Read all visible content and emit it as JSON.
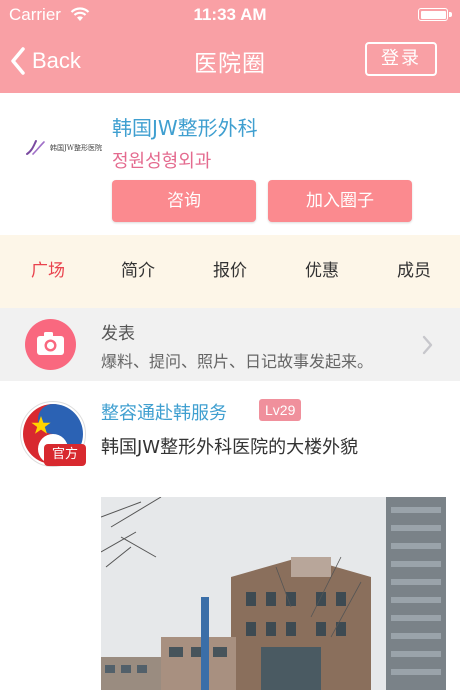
{
  "status_bar": {
    "carrier": "Carrier",
    "time": "11:33 AM"
  },
  "nav": {
    "back_label": "Back",
    "title": "医院圈",
    "login_label": "登录"
  },
  "hospital": {
    "logo_text": "韩国JW整形医院",
    "name_cn": "韩国JW整形外科",
    "name_kr": "정원성형외과",
    "consult_label": "咨询",
    "join_label": "加入圈子"
  },
  "tabs": [
    {
      "label": "广场",
      "active": true
    },
    {
      "label": "简介"
    },
    {
      "label": "报价"
    },
    {
      "label": "优惠"
    },
    {
      "label": "成员"
    }
  ],
  "post": {
    "title": "发表",
    "subtitle": "爆料、提问、照片、日记故事发起来。"
  },
  "feed": {
    "user": "整容通赴韩服务",
    "level": "Lv29",
    "official_badge": "官方",
    "text": "韩国JW整形外科医院的大楼外貌"
  },
  "colors": {
    "header": "#f9a0a5",
    "accent": "#fb8a8f",
    "link_blue": "#3f9fd0",
    "active_tab": "#e9424d"
  }
}
